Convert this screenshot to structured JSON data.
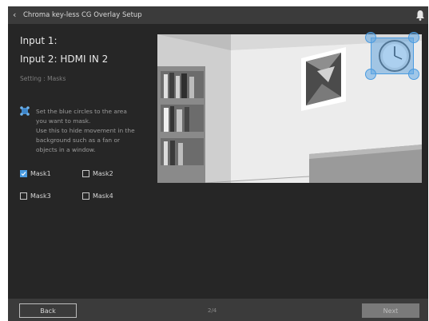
{
  "titlebar": {
    "title": "Chroma key-less CG Overlay Setup",
    "back_icon": "chevron-left-icon",
    "notification_icon": "bell-icon"
  },
  "heading": {
    "input1": "Input 1:",
    "input2": "Input 2: HDMI IN 2"
  },
  "setting_label": "Setting : Masks",
  "instruction": {
    "icon": "mask-handles-icon",
    "lines": [
      "Set the blue circles to the area",
      "you want to mask.",
      "Use this to hide movement in the",
      "background such as a fan or",
      "objects in a window."
    ]
  },
  "masks": [
    {
      "label": "Mask1",
      "checked": true
    },
    {
      "label": "Mask2",
      "checked": false
    },
    {
      "label": "Mask3",
      "checked": false
    },
    {
      "label": "Mask4",
      "checked": false
    }
  ],
  "footer": {
    "back_label": "Back",
    "page_indicator": "2/4",
    "next_label": "Next"
  },
  "colors": {
    "accent": "#4a9be0",
    "background": "#262626",
    "bar": "#3b3b3b"
  }
}
